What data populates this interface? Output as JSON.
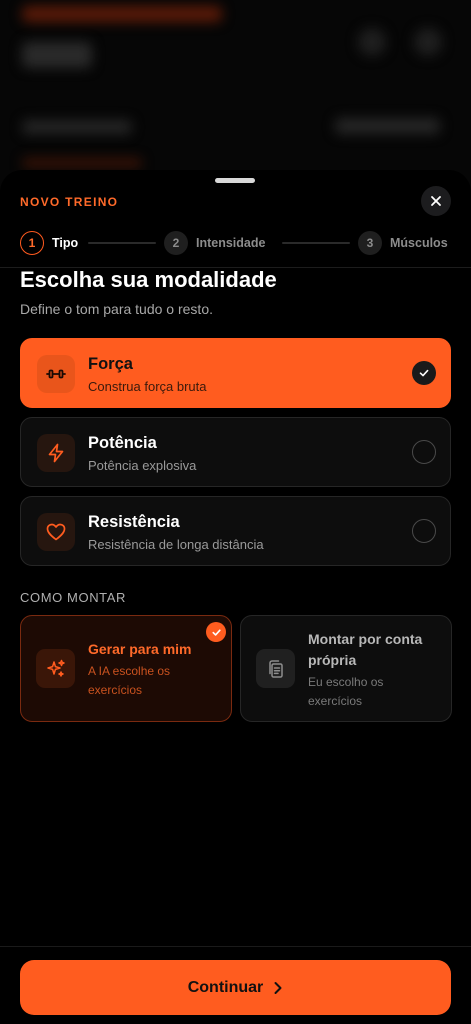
{
  "sheet": {
    "kicker": "NOVO TREINO",
    "close_icon": "close-icon"
  },
  "stepper": {
    "steps": [
      {
        "number": "1",
        "label": "Tipo",
        "state": "active"
      },
      {
        "number": "2",
        "label": "Intensidade",
        "state": "upcoming"
      },
      {
        "number": "3",
        "label": "Músculos",
        "state": "upcoming"
      }
    ]
  },
  "header": {
    "title": "Escolha sua modalidade",
    "subtitle": "Define o tom para tudo o resto."
  },
  "modalities": [
    {
      "icon": "dumbbell-icon",
      "title": "Força",
      "description": "Construa força bruta",
      "selected": true
    },
    {
      "icon": "lightning-icon",
      "title": "Potência",
      "description": "Potência explosiva",
      "selected": false
    },
    {
      "icon": "heart-icon",
      "title": "Resistência",
      "description": "Resistência de longa distância",
      "selected": false
    }
  ],
  "build": {
    "section_label": "COMO MONTAR",
    "options": [
      {
        "icon": "sparkles-icon",
        "title": "Gerar para mim",
        "description": "A IA escolhe os exercícios",
        "selected": true
      },
      {
        "icon": "clipboard-icon",
        "title": "Montar por conta própria",
        "description": "Eu escolho os exercícios",
        "selected": false
      }
    ]
  },
  "footer": {
    "continue_label": "Continuar",
    "continue_icon": "chevron-right-icon"
  },
  "colors": {
    "accent": "#ff5c1f",
    "background": "#000000",
    "card": "#0d0d0d"
  }
}
